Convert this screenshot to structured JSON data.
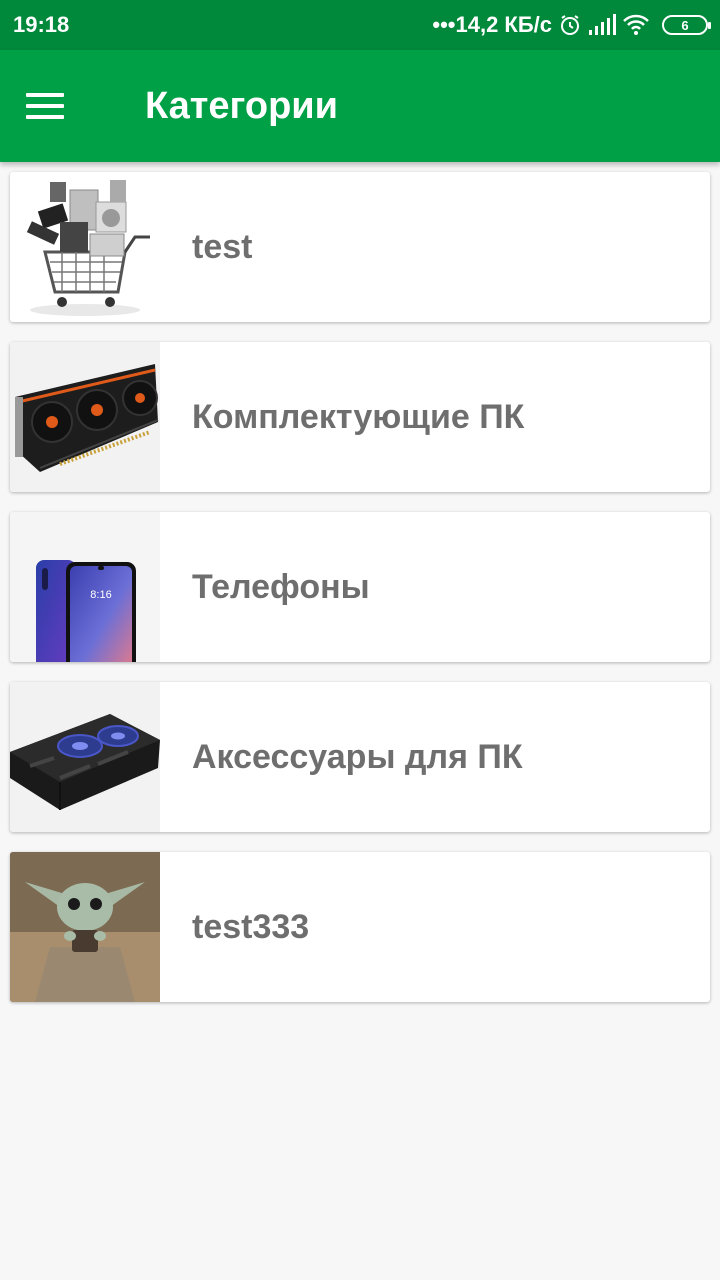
{
  "status_bar": {
    "time": "19:18",
    "network_speed": "•••14,2 КБ/с",
    "battery_level": "6",
    "icons": [
      "alarm-icon",
      "signal-icon",
      "wifi-icon",
      "battery-icon"
    ]
  },
  "app_bar": {
    "title": "Категории",
    "menu_icon": "hamburger-menu-icon",
    "color": "#00a046",
    "status_color": "#00883b"
  },
  "categories": [
    {
      "label": "test",
      "image": "shopping-cart-electronics"
    },
    {
      "label": "Комплектующие ПК",
      "image": "graphics-card"
    },
    {
      "label": "Телефоны",
      "image": "smartphone"
    },
    {
      "label": "Аксессуары для ПК",
      "image": "laptop-cooling-pad"
    },
    {
      "label": "test333",
      "image": "baby-yoda"
    }
  ],
  "text_color": "#6e6e6e"
}
